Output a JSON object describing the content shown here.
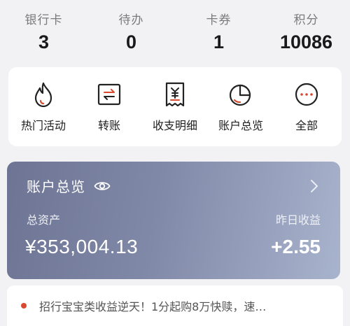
{
  "stats": [
    {
      "label": "银行卡",
      "value": "3"
    },
    {
      "label": "待办",
      "value": "0"
    },
    {
      "label": "卡券",
      "value": "1"
    },
    {
      "label": "积分",
      "value": "10086"
    }
  ],
  "shortcuts": [
    {
      "label": "热门活动",
      "icon": "flame-icon"
    },
    {
      "label": "转账",
      "icon": "transfer-icon"
    },
    {
      "label": "收支明细",
      "icon": "receipt-icon"
    },
    {
      "label": "账户总览",
      "icon": "pie-chart-icon"
    },
    {
      "label": "全部",
      "icon": "more-icon"
    }
  ],
  "account": {
    "title": "账户总览",
    "total_label": "总资产",
    "total_value": "¥353,004.13",
    "yesterday_label": "昨日收益",
    "yesterday_value": "+2.55"
  },
  "notice": {
    "text": "招行宝宝类收益逆天！1分起购8万快赎，速…"
  },
  "colors": {
    "accent": "#d9492f",
    "card_gradient_start": "#6d7494",
    "card_gradient_end": "#a8b3cd"
  }
}
